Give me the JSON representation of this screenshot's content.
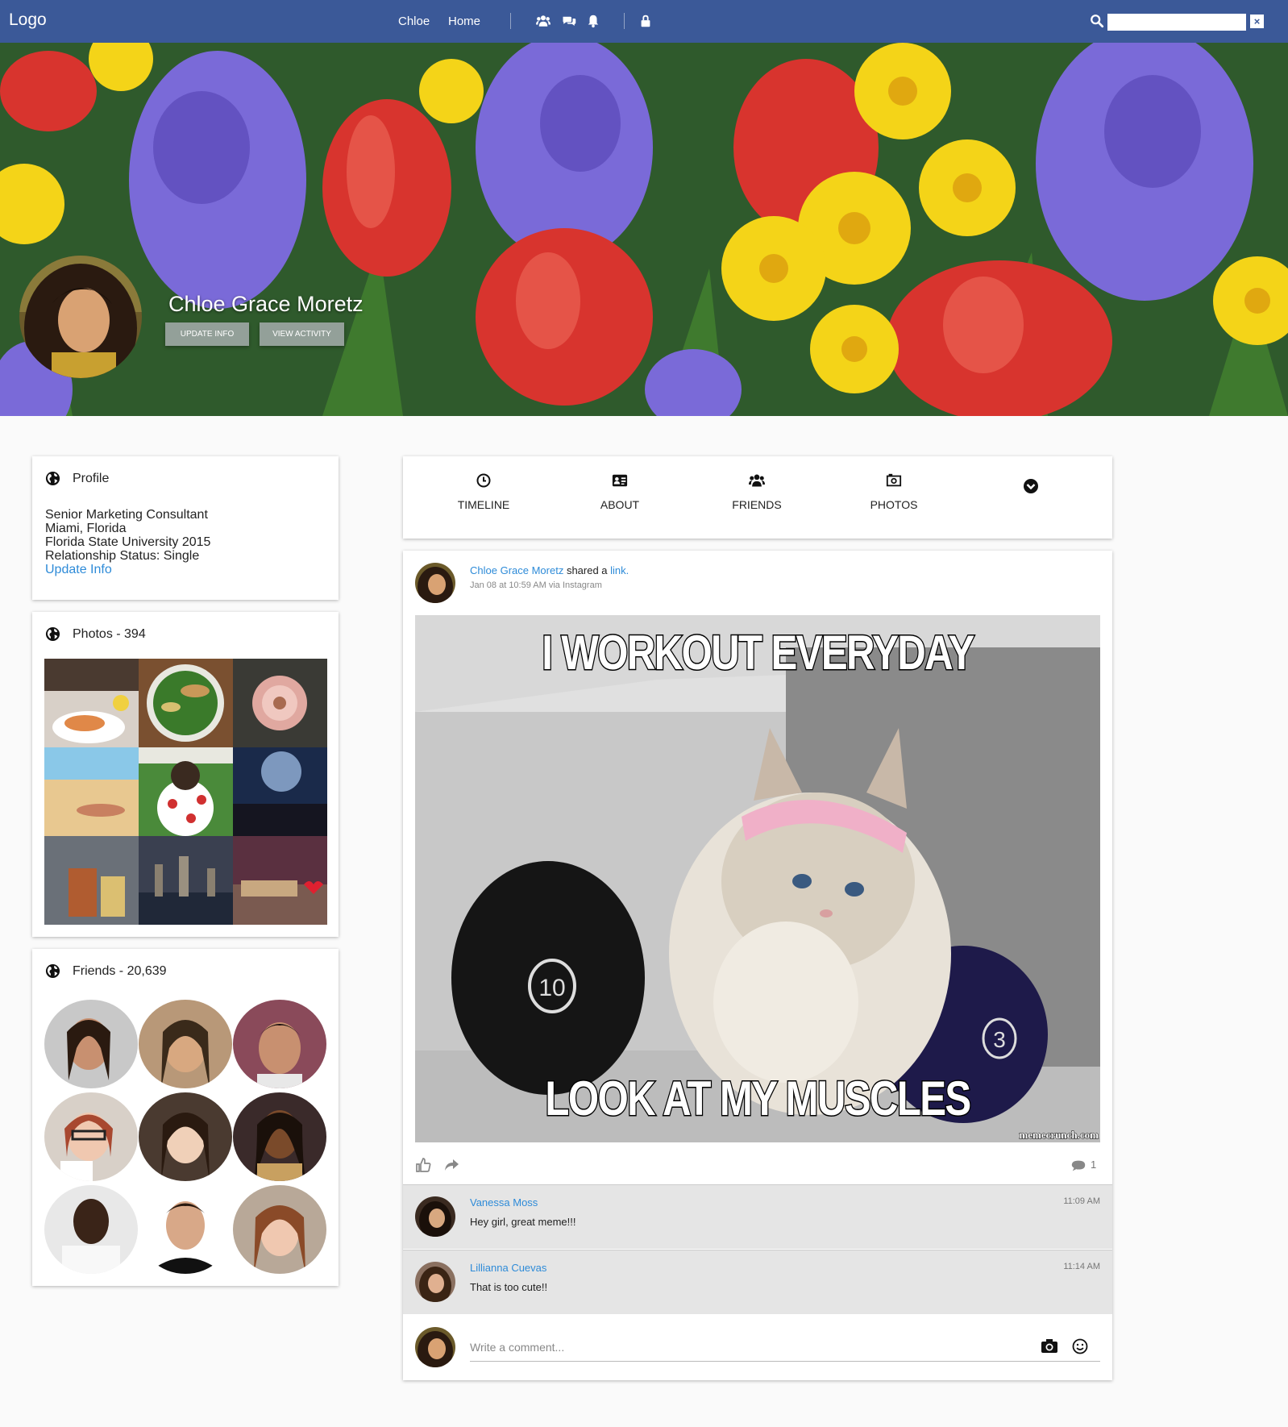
{
  "navbar": {
    "logo": "Logo",
    "links": [
      "Chloe",
      "Home"
    ],
    "icons": [
      "friends-icon",
      "messages-icon",
      "notifications-icon",
      "lock-icon"
    ],
    "search_placeholder": "",
    "search_clear": "×",
    "background": "#3b5998"
  },
  "cover": {
    "name": "Chloe Grace Moretz",
    "buttons": [
      "UPDATE INFO",
      "VIEW ACTIVITY"
    ]
  },
  "profile_card": {
    "title": "Profile",
    "lines": [
      "Senior Marketing Consultant",
      "Miami, Florida",
      "Florida State University 2015",
      "Relationship Status: Single"
    ],
    "update_link": "Update Info"
  },
  "photos_card": {
    "title": "Photos - 394",
    "photos": [
      "salmon-dish",
      "salad-bowl",
      "pink-flower",
      "beach-woman",
      "puppy-in-cup",
      "concert-crowd",
      "iced-drinks",
      "city-skyline",
      "love-blocks"
    ]
  },
  "friends_card": {
    "title": "Friends - 20,639",
    "friends": [
      "friend-1",
      "friend-2",
      "friend-3",
      "friend-4",
      "friend-5",
      "friend-6",
      "friend-7",
      "friend-8",
      "friend-9"
    ]
  },
  "tabs": [
    {
      "label": "TIMELINE",
      "icon": "clock-icon"
    },
    {
      "label": "ABOUT",
      "icon": "id-card-icon"
    },
    {
      "label": "FRIENDS",
      "icon": "friends-icon"
    },
    {
      "label": "PHOTOS",
      "icon": "camera-icon"
    },
    {
      "label": "",
      "icon": "chevron-down-circle-icon"
    }
  ],
  "post": {
    "author": "Chloe Grace Moretz",
    "action": " shared a ",
    "object": "link.",
    "meta": "Jan 08 at 10:59 AM via Instagram",
    "meme_top": "I WORKOUT EVERYDAY",
    "meme_bottom": "LOOK AT MY MUSCLES",
    "meme_credit": "memecrunch.com",
    "comment_count": "1",
    "comments": [
      {
        "name": "Vanessa Moss",
        "text": "Hey girl, great meme!!!",
        "time": "11:09 AM"
      },
      {
        "name": "Lillianna Cuevas",
        "text": "That is too cute!!",
        "time": "11:14 AM"
      }
    ],
    "comment_placeholder": "Write a comment..."
  },
  "colors": {
    "link": "#2e8bd8",
    "comment_bg": "#e5e5e5",
    "page_bg": "#fafafa"
  }
}
